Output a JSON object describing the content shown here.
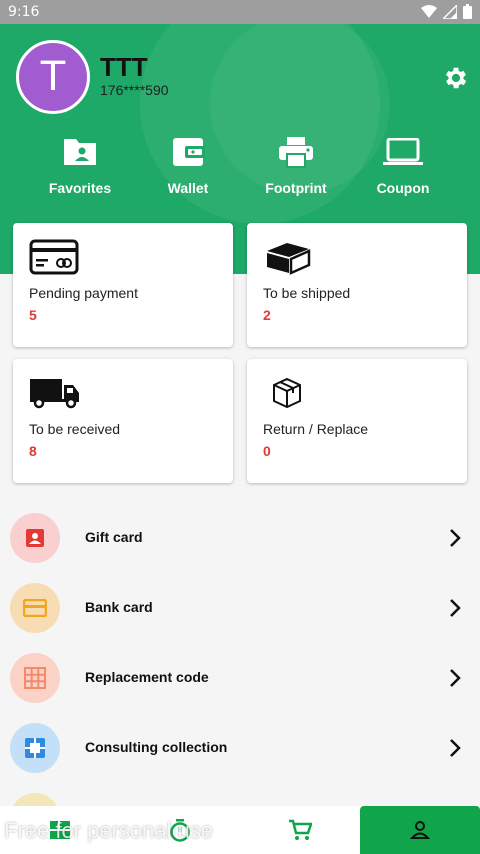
{
  "status_bar": {
    "time": "9:16"
  },
  "profile": {
    "avatar_letter": "T",
    "name": "TTT",
    "phone": "176****590"
  },
  "quick_links": [
    {
      "label": "Favorites",
      "icon": "folder-person-icon"
    },
    {
      "label": "Wallet",
      "icon": "wallet-icon"
    },
    {
      "label": "Footprint",
      "icon": "printer-icon"
    },
    {
      "label": "Coupon",
      "icon": "laptop-icon"
    }
  ],
  "orders": [
    {
      "label": "Pending payment",
      "count": "5",
      "icon": "card-icon"
    },
    {
      "label": "To be shipped",
      "count": "2",
      "icon": "box-icon"
    },
    {
      "label": "To be received",
      "count": "8",
      "icon": "truck-icon"
    },
    {
      "label": "Return / Replace",
      "count": "0",
      "icon": "package-icon"
    }
  ],
  "menu": [
    {
      "label": "Gift card",
      "icon": "gift-card-icon",
      "bg": "#f9cfcf",
      "fg": "#e53935"
    },
    {
      "label": "Bank card",
      "icon": "bank-card-icon",
      "bg": "#f8dcb4",
      "fg": "#f0a71b"
    },
    {
      "label": "Replacement code",
      "icon": "grid-icon",
      "bg": "#fbd2c6",
      "fg": "#f48a6b"
    },
    {
      "label": "Consulting collection",
      "icon": "frame-icon",
      "bg": "#c4e0f8",
      "fg": "#2f8ae0"
    }
  ],
  "bottom_nav": [
    {
      "name": "home"
    },
    {
      "name": "timer"
    },
    {
      "name": "cart"
    },
    {
      "name": "profile",
      "active": true
    }
  ],
  "watermark": "Free for personal use",
  "colors": {
    "header": "#1fa968",
    "accent": "#10a54a",
    "count": "#e53935",
    "avatar": "#a15dd0"
  }
}
